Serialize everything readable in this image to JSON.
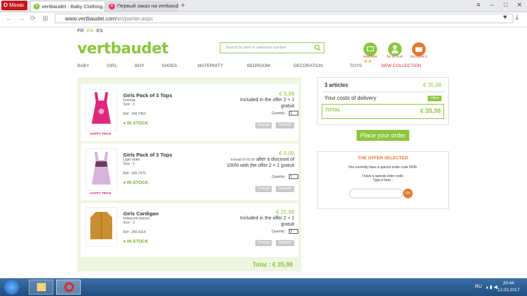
{
  "browser": {
    "menu_label": "Меню",
    "tabs": [
      {
        "label": "vertbaudet - Baby Clothing...",
        "active": true
      },
      {
        "label": "Первый заказ на vertbaud...",
        "active": false
      }
    ],
    "url_prefix": "www.vertbaudet.com",
    "url_path": "/en/panier.aspx"
  },
  "site": {
    "languages": [
      "FR",
      "EN",
      "ES"
    ],
    "logo_text": "vertbaudet",
    "search_placeholder": "Search by item or reference number",
    "account_links": [
      "Newsletter",
      "My account",
      "My basket 3"
    ],
    "nav": [
      "BABY",
      "GIRL",
      "BOY",
      "SHOES",
      "MATERNITY",
      "BEDROOM",
      "DECORATION",
      "TOYS",
      "NEW COLLECTION"
    ]
  },
  "cart": {
    "items": [
      {
        "title": "Girls Pack of 3 Tops",
        "color": "Fuchsia",
        "size": "Size : 2",
        "ref": "Réf : 240.7453",
        "stock": "IN STOCK",
        "badge": "HAPPY PRICE",
        "price": "€ 9,99",
        "instead": "",
        "offer": "Included in the offer 2 + 1 gratuit",
        "qty_label": "Quantity :",
        "qty": "1",
        "change": "Change",
        "delete": "Deleted"
      },
      {
        "title": "Girls Pack of 3 Tops",
        "color": "Light violet",
        "size": "Size : 2",
        "ref": "Réf : 240.7470",
        "stock": "IN STOCK",
        "badge": "HAPPY PRICE",
        "price": "€ 0,00",
        "instead": "instead of €9.99",
        "offer": "after a discount of 100% with the offer 2 + 1 gratuit",
        "qty_label": "Quantity :",
        "qty": "1",
        "change": "Change",
        "delete": "Deleted"
      },
      {
        "title": "Girls Cardigan",
        "color": "Iridescent bronze",
        "size": "Size : 2",
        "ref": "Réf : 240.5914",
        "stock": "IN STOCK",
        "badge": "",
        "price": "€ 25,99",
        "instead": "",
        "offer": "Included in the offer 2 + 1 gratuit",
        "qty_label": "Quantity :",
        "qty": "1",
        "change": "Change",
        "delete": "Deleted"
      }
    ],
    "total": "Total : € 35,98"
  },
  "summary": {
    "articles_label": "3 articles",
    "articles_value": "€ 35,98",
    "delivery_label": "Your costs of delivery",
    "delivery_value": "Offert",
    "total_label": "TOTAL :",
    "total_value": "€ 35,98",
    "place_order": "Place your order"
  },
  "offer_box": {
    "title": "THE OFFER SELECTED",
    "line1": "You currently have a special order code 0036.",
    "line2": "I have a special order code.",
    "line3": "Type it here :",
    "ok": "OK"
  },
  "taskbar": {
    "lang": "RU",
    "time": "20:44",
    "date": "12.03.2017"
  },
  "colors": {
    "brand_green": "#8cc63f",
    "offer_orange": "#e6772e",
    "browser_red": "#c3171c"
  }
}
